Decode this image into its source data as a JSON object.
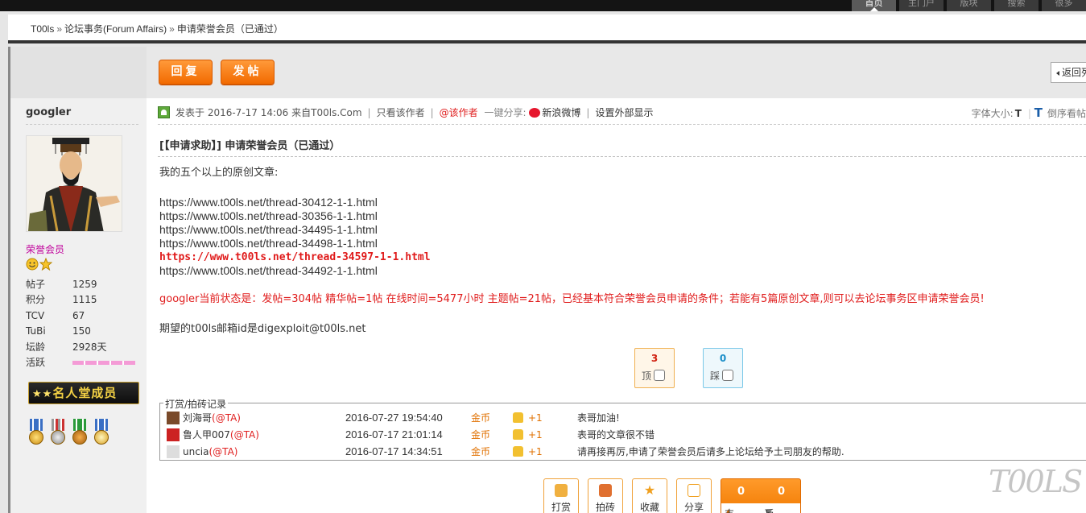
{
  "topnav": [
    "首页",
    "主门户",
    "版块",
    "搜索",
    "很多"
  ],
  "breadcrumb": {
    "items": [
      "T00ls",
      "论坛事务(Forum Affairs)",
      "申请荣誉会员（已通过）"
    ],
    "sep": "»"
  },
  "toolbar": {
    "reply_label": "回复",
    "post_label": "发帖",
    "back_label": "返回列表"
  },
  "author": {
    "name": "googler",
    "usergroup": "荣誉会员",
    "stats": [
      {
        "k": "帖子",
        "v": "1259"
      },
      {
        "k": "积分",
        "v": "1115"
      },
      {
        "k": "TCV",
        "v": "67"
      },
      {
        "k": "TuBi",
        "v": "150"
      },
      {
        "k": "坛龄",
        "v": "2928天"
      },
      {
        "k": "活跃",
        "v": ""
      }
    ],
    "hall_label": "名人堂成员",
    "hall_stars": "★★"
  },
  "meta": {
    "posted": "发表于 2016-7-17 14:06 来自T00ls.Com",
    "only_author": "只看该作者",
    "at_author": "@该作者",
    "share_label": "一键分享:",
    "weibo": "新浪微博",
    "external": "设置外部显示",
    "font_size_label": "字体大小:",
    "font_small": "T",
    "font_large": "T",
    "reverse": "倒序看帖"
  },
  "thread": {
    "title": "[【申请求助】] 申请荣誉会员（已通过）",
    "intro": "我的五个以上的原创文章:",
    "links": [
      "https://www.t00ls.net/thread-30412-1-1.html",
      "https://www.t00ls.net/thread-30356-1-1.html",
      "https://www.t00ls.net/thread-34495-1-1.html",
      "https://www.t00ls.net/thread-34498-1-1.html",
      "https://www.t00ls.net/thread-34597-1-1.html",
      "https://www.t00ls.net/thread-34492-1-1.html"
    ],
    "status": "googler当前状态是：发帖=304帖 精华帖=1帖 在线时间=5477小时 主题帖=21帖，已经基本符合荣誉会员申请的条件；若能有5篇原创文章,则可以去论坛事务区申请荣誉会员!",
    "email": "期望的t00ls邮箱id是digexploit@t00ls.net"
  },
  "votes": {
    "up": {
      "count": "3",
      "label": "顶"
    },
    "down": {
      "count": "0",
      "label": "踩"
    }
  },
  "ratelog": {
    "legend": "打赏/拍砖记录",
    "rows": [
      {
        "user": "刘海哥",
        "at": "(@TA)",
        "time": "2016-07-27 19:54:40",
        "coin": "金币",
        "amount": "+1",
        "reason": "表哥加油!"
      },
      {
        "user": "鲁人甲007",
        "at": "(@TA)",
        "time": "2016-07-17 21:01:14",
        "coin": "金币",
        "amount": "+1",
        "reason": "表哥的文章很不错"
      },
      {
        "user": "uncia",
        "at": "(@TA)",
        "time": "2016-07-17 14:34:51",
        "coin": "金币",
        "amount": "+1",
        "reason": "请再接再厉,申请了荣誉会员后请多上论坛给予土司朋友的帮助."
      }
    ]
  },
  "actions": {
    "reward": "打赏",
    "brick": "拍砖",
    "favorite": "收藏",
    "share": "分享",
    "support_count": "0",
    "oppose_count": "0",
    "support": "支持",
    "oppose": "反对"
  },
  "watermark": "T00LS",
  "colors": {
    "accent": "#f26a00",
    "red": "#e01b1b",
    "usergroup": "#c0009b"
  }
}
